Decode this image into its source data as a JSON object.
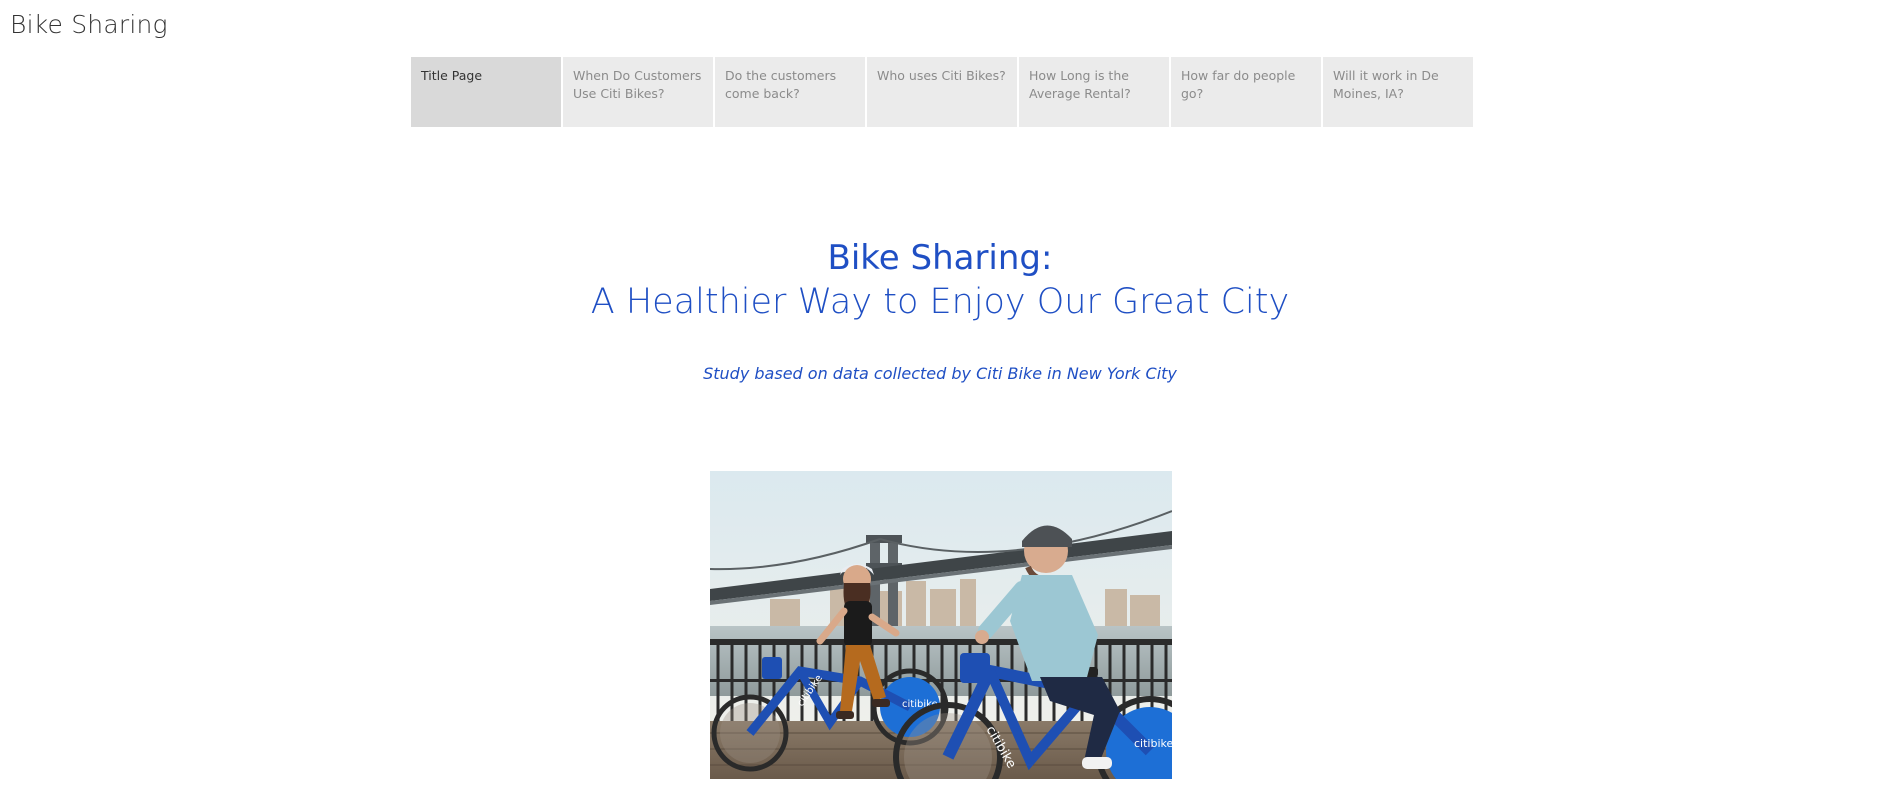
{
  "app": {
    "title": "Bike Sharing"
  },
  "tabs": [
    {
      "label": "Title Page",
      "active": true
    },
    {
      "label": "When Do Customers Use Citi Bikes?",
      "active": false
    },
    {
      "label": "Do the customers come back?",
      "active": false
    },
    {
      "label": "Who uses Citi Bikes?",
      "active": false
    },
    {
      "label": "How Long is the Average Rental?",
      "active": false
    },
    {
      "label": "How far do people go?",
      "active": false
    },
    {
      "label": "Will it work in De Moines, IA?",
      "active": false
    }
  ],
  "main": {
    "headline_line1": "Bike Sharing:",
    "headline_line2": "A Healthier Way to Enjoy Our Great City",
    "subtitle": "Study based on data collected by Citi Bike in New York City"
  },
  "photo": {
    "brand_text": "citibike"
  },
  "colors": {
    "accent": "#1f4fc4",
    "tab_bg": "#ebebeb",
    "tab_active_bg": "#d9d9d9"
  }
}
